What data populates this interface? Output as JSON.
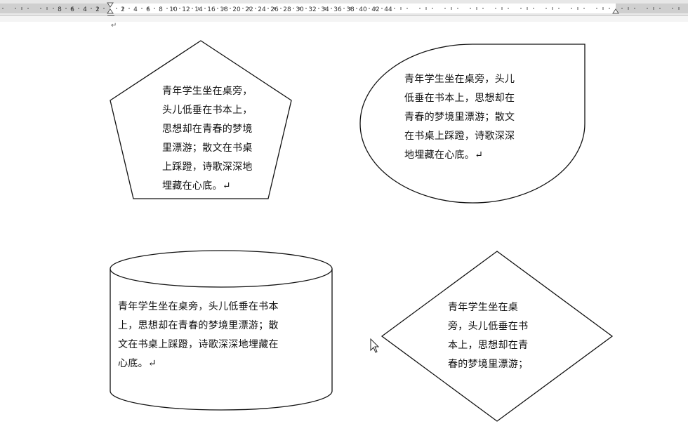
{
  "ruler": {
    "tick_labels": [
      "8",
      "6",
      "4",
      "2",
      "2",
      "4",
      "6",
      "8",
      "10",
      "12",
      "14",
      "16",
      "18",
      "20",
      "22",
      "24",
      "26",
      "28",
      "30",
      "32",
      "34",
      "36",
      "38",
      "40",
      "42",
      "44"
    ]
  },
  "paragraph_mark": "↵",
  "shapes": {
    "pentagon": {
      "text": "青年学生坐在桌旁，\n头儿低垂在书本上，\n思想却在青春的梦境\n里漂游；散文在书桌\n上踩蹬，诗歌深深地\n埋藏在心底。↵"
    },
    "teardrop": {
      "text": "青年学生坐在桌旁，头儿\n低垂在书本上，思想却在\n青春的梦境里漂游；散文\n在书桌上踩蹬，诗歌深深\n地埋藏在心底。↵"
    },
    "cylinder": {
      "text": "青年学生坐在桌旁，头儿低垂在书本\n上，思想却在青春的梦境里漂游；散\n文在书桌上踩蹬，诗歌深深地埋藏在\n心底。↵"
    },
    "diamond": {
      "text": "青年学生坐在桌\n旁，头儿低垂在书\n本上，思想却在青\n春的梦境里漂游；"
    }
  }
}
